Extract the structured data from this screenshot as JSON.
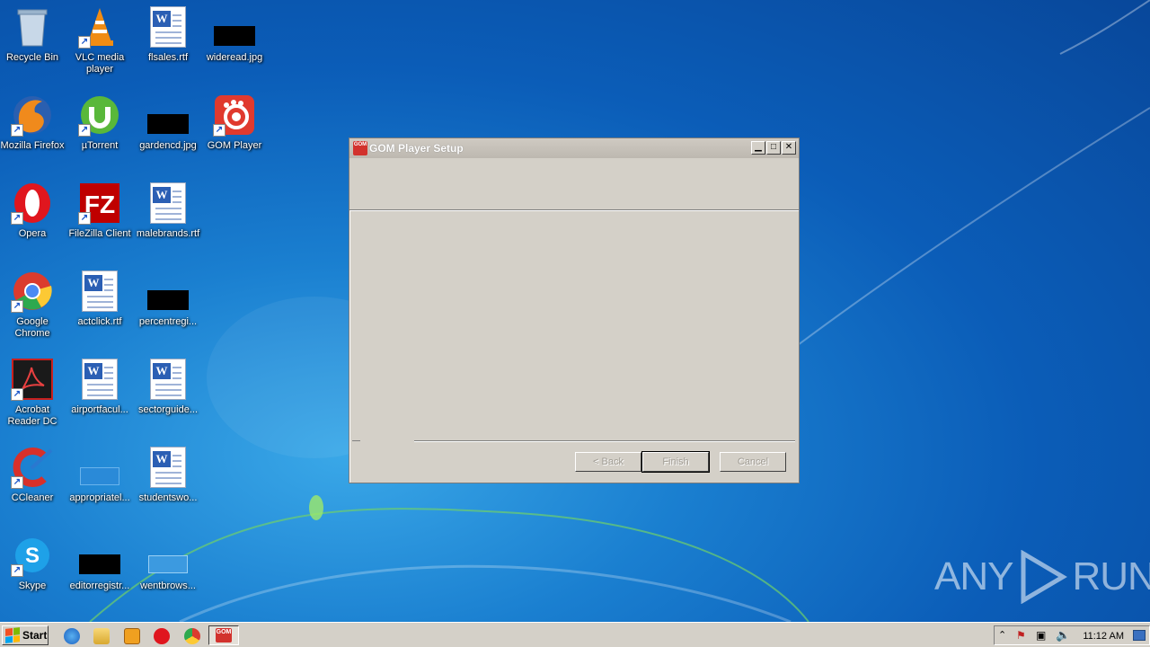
{
  "desktop": {
    "icons": [
      {
        "label": "Recycle Bin"
      },
      {
        "label": "VLC media player"
      },
      {
        "label": "flsales.rtf"
      },
      {
        "label": "wideread.jpg"
      },
      {
        "label": "Mozilla Firefox"
      },
      {
        "label": "µTorrent"
      },
      {
        "label": "gardencd.jpg"
      },
      {
        "label": "GOM Player"
      },
      {
        "label": "Opera"
      },
      {
        "label": "FileZilla Client"
      },
      {
        "label": "malebrands.rtf"
      },
      {
        "label": "Google Chrome"
      },
      {
        "label": "actclick.rtf"
      },
      {
        "label": "percentregi..."
      },
      {
        "label": "Acrobat Reader DC"
      },
      {
        "label": "airportfacul..."
      },
      {
        "label": "sectorguide..."
      },
      {
        "label": "CCleaner"
      },
      {
        "label": "appropriatel..."
      },
      {
        "label": "studentswo..."
      },
      {
        "label": "Skype"
      },
      {
        "label": "editorregistr..."
      },
      {
        "label": "wentbrows..."
      }
    ]
  },
  "dialog": {
    "icon_text": "GOM",
    "title": "GOM Player Setup",
    "buttons": {
      "back": "< Back",
      "finish": "Finish",
      "cancel": "Cancel"
    }
  },
  "taskbar": {
    "start_label": "Start",
    "clock": "11:12 AM",
    "active_app_icon_text": "GOM"
  },
  "watermark": {
    "left": "ANY",
    "right": "RUN"
  },
  "colors": {
    "accent_red": "#d2322d",
    "dialog_bg": "#d4d0c8"
  }
}
